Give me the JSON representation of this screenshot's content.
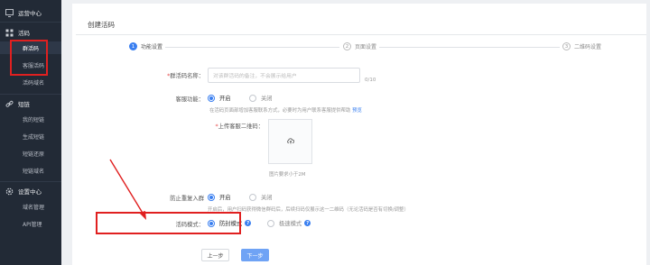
{
  "sidebar": {
    "sections": [
      {
        "label": "运营中心"
      },
      {
        "label": "活码"
      },
      {
        "label": "短链"
      },
      {
        "label": "设置中心"
      }
    ],
    "items": [
      {
        "label": "群活码"
      },
      {
        "label": "客服活码"
      },
      {
        "label": "活码域名"
      },
      {
        "label": "我的短链"
      },
      {
        "label": "生成短链"
      },
      {
        "label": "短链还原"
      },
      {
        "label": "短链域名"
      },
      {
        "label": "域名管理"
      },
      {
        "label": "API管理"
      }
    ]
  },
  "page": {
    "title": "创建活码"
  },
  "steps": [
    {
      "num": "1",
      "label": "功能设置"
    },
    {
      "num": "2",
      "label": "页面设置"
    },
    {
      "num": "3",
      "label": "二维码设置"
    }
  ],
  "form": {
    "name_label": "群活码名称：",
    "name_placeholder": "对该群活码的备注，不会展示给用户",
    "name_counter": "0/10",
    "service_label": "客服功能：",
    "service_on": "开启",
    "service_off": "关闭",
    "service_hint": "在活码页面部增加客服联系方式，必要时为用户联系客服提供帮助",
    "service_hint_link": "预览",
    "upload_label": "上传客服二维码：",
    "upload_hint": "图片要求小于2M",
    "dup_label": "防止重复入群",
    "dup_on": "开启",
    "dup_off": "关闭",
    "dup_hint": "开启后，用户扫码获得微信群码后，后续扫码仅展示这一二维码（无论活码是否有切换/调整）",
    "mode_label": "活码模式：",
    "mode_option1": "防封模式",
    "mode_option2": "极速模式",
    "mode_qmark": "?"
  },
  "buttons": {
    "prev": "上一步",
    "next": "下一步"
  },
  "colors": {
    "sidebar_bg": "#222a36",
    "accent": "#3a7ff0",
    "annotation": "#e02020"
  }
}
